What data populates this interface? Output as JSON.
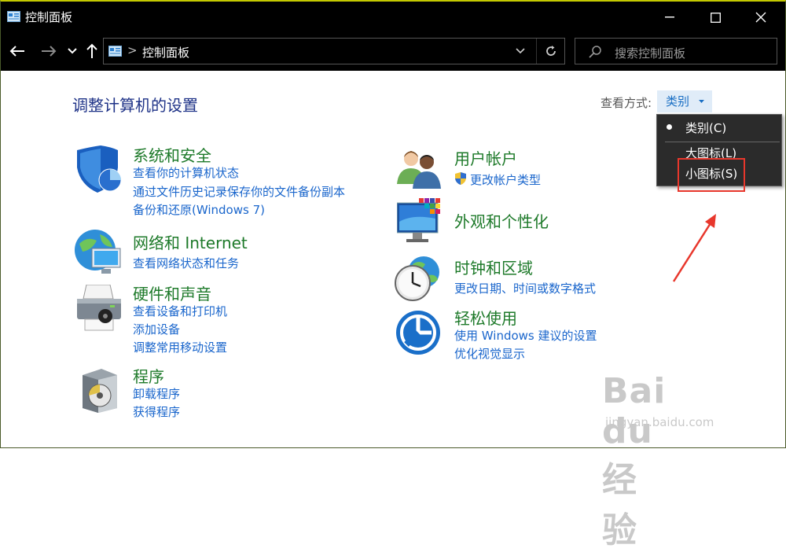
{
  "window": {
    "title": "控制面板"
  },
  "address": {
    "path": "控制面板",
    "separator": ">"
  },
  "search": {
    "placeholder": "搜索控制面板"
  },
  "heading": "调整计算机的设置",
  "view": {
    "label": "查看方式:",
    "selected": "类别",
    "menu": [
      "类别(C)",
      "大图标(L)",
      "小图标(S)"
    ]
  },
  "categories": [
    {
      "title": "系统和安全",
      "links": [
        "查看你的计算机状态",
        "通过文件历史记录保存你的文件备份副本",
        "备份和还原(Windows 7)"
      ]
    },
    {
      "title": "网络和 Internet",
      "links": [
        "查看网络状态和任务"
      ]
    },
    {
      "title": "硬件和声音",
      "links": [
        "查看设备和打印机",
        "添加设备",
        "调整常用移动设置"
      ]
    },
    {
      "title": "程序",
      "links": [
        "卸载程序",
        "获得程序"
      ]
    },
    {
      "title": "用户帐户",
      "links": [
        "更改帐户类型"
      ]
    },
    {
      "title": "外观和个性化",
      "links": []
    },
    {
      "title": "时钟和区域",
      "links": [
        "更改日期、时间或数字格式"
      ]
    },
    {
      "title": "轻松使用",
      "links": [
        "使用 Windows 建议的设置",
        "优化视觉显示"
      ]
    }
  ],
  "watermark": {
    "logo": "Bai du 经验",
    "url": "jingyan.baidu.com"
  },
  "colors": {
    "titlebar": "#000000",
    "heading": "#1e3287",
    "category": "#1e7a2a",
    "link": "#1a66cc",
    "highlight": "#e8372c"
  }
}
